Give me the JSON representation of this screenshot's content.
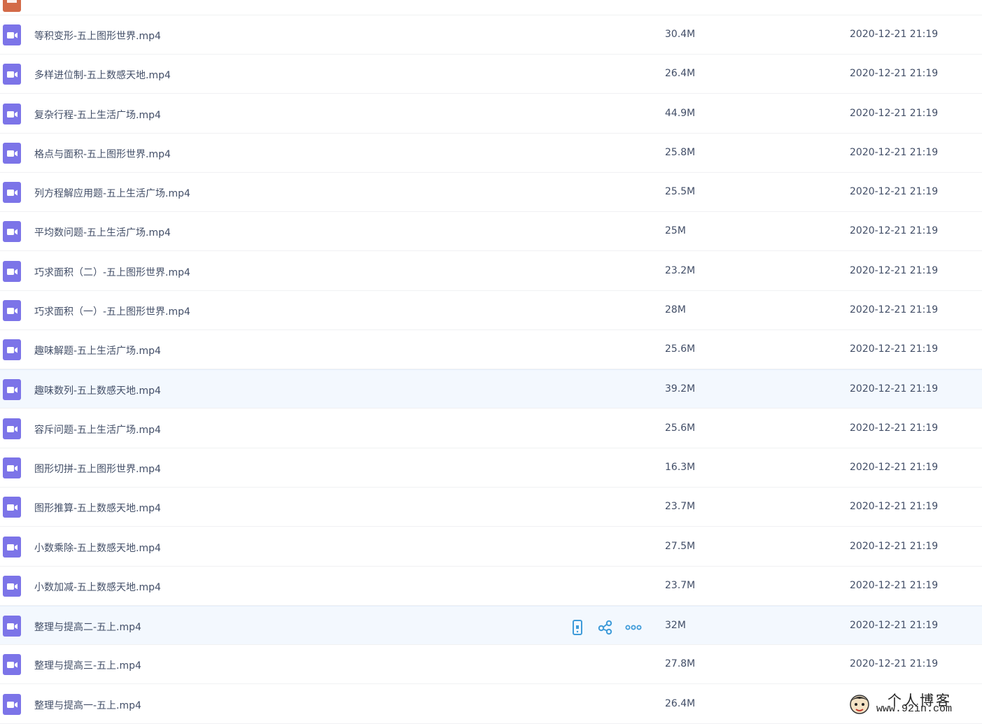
{
  "colors": {
    "video_icon": "#7c74e8",
    "folder_icon": "#d36a48",
    "action_icon": "#3f9bd9",
    "text": "#424e67",
    "highlight_row": "#f3f8fe"
  },
  "files": [
    {
      "name": "等积变形-五上图形世界.mp4",
      "size": "30.4M",
      "date": "2020-12-21 21:19",
      "icon": "video-icon"
    },
    {
      "name": "多样进位制-五上数感天地.mp4",
      "size": "26.4M",
      "date": "2020-12-21 21:19",
      "icon": "video-icon"
    },
    {
      "name": "复杂行程-五上生活广场.mp4",
      "size": "44.9M",
      "date": "2020-12-21 21:19",
      "icon": "video-icon"
    },
    {
      "name": "格点与面积-五上图形世界.mp4",
      "size": "25.8M",
      "date": "2020-12-21 21:19",
      "icon": "video-icon"
    },
    {
      "name": "列方程解应用题-五上生活广场.mp4",
      "size": "25.5M",
      "date": "2020-12-21 21:19",
      "icon": "video-icon"
    },
    {
      "name": "平均数问题-五上生活广场.mp4",
      "size": "25M",
      "date": "2020-12-21 21:19",
      "icon": "video-icon"
    },
    {
      "name": "巧求面积（二）-五上图形世界.mp4",
      "size": "23.2M",
      "date": "2020-12-21 21:19",
      "icon": "video-icon"
    },
    {
      "name": "巧求面积（一）-五上图形世界.mp4",
      "size": "28M",
      "date": "2020-12-21 21:19",
      "icon": "video-icon"
    },
    {
      "name": "趣味解题-五上生活广场.mp4",
      "size": "25.6M",
      "date": "2020-12-21 21:19",
      "icon": "video-icon"
    },
    {
      "name": "趣味数列-五上数感天地.mp4",
      "size": "39.2M",
      "date": "2020-12-21 21:19",
      "icon": "video-icon"
    },
    {
      "name": "容斥问题-五上生活广场.mp4",
      "size": "25.6M",
      "date": "2020-12-21 21:19",
      "icon": "video-icon"
    },
    {
      "name": "图形切拼-五上图形世界.mp4",
      "size": "16.3M",
      "date": "2020-12-21 21:19",
      "icon": "video-icon"
    },
    {
      "name": "图形推算-五上数感天地.mp4",
      "size": "23.7M",
      "date": "2020-12-21 21:19",
      "icon": "video-icon"
    },
    {
      "name": "小数乘除-五上数感天地.mp4",
      "size": "27.5M",
      "date": "2020-12-21 21:19",
      "icon": "video-icon"
    },
    {
      "name": "小数加减-五上数感天地.mp4",
      "size": "23.7M",
      "date": "2020-12-21 21:19",
      "icon": "video-icon"
    },
    {
      "name": "整理与提高二-五上.mp4",
      "size": "32M",
      "date": "2020-12-21 21:19",
      "icon": "video-icon"
    },
    {
      "name": "整理与提高三-五上.mp4",
      "size": "27.8M",
      "date": "2020-12-21 21:19",
      "icon": "video-icon"
    },
    {
      "name": "整理与提高一-五上.mp4",
      "size": "26.4M",
      "date": "",
      "icon": "video-icon"
    }
  ],
  "highlighted_rows": [
    9,
    15
  ],
  "hover_row": 15,
  "hover_actions": [
    {
      "name": "send-to-phone-icon",
      "title": "phone"
    },
    {
      "name": "share-icon",
      "title": "share"
    },
    {
      "name": "more-icon",
      "title": "more"
    }
  ],
  "watermark": {
    "title": "个人博客",
    "url": "www.92in.com"
  }
}
